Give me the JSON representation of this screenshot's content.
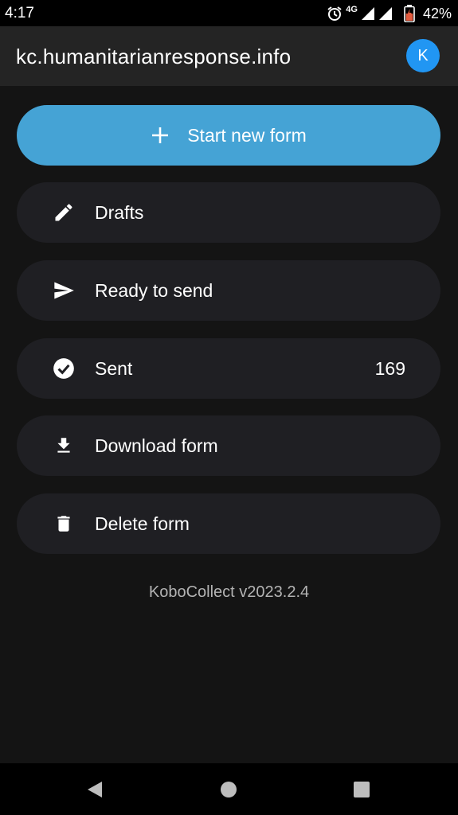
{
  "status_bar": {
    "time": "4:17",
    "network": "4G",
    "battery_percent": "42%"
  },
  "app_bar": {
    "title": "kc.humanitarianresponse.info",
    "avatar_letter": "K"
  },
  "actions": {
    "start_new_form": "Start new form",
    "drafts": "Drafts",
    "ready_to_send": "Ready to send",
    "sent": "Sent",
    "sent_count": "169",
    "download_form": "Download form",
    "delete_form": "Delete form"
  },
  "version": "KoboCollect v2023.2.4",
  "colors": {
    "primary": "#45a3d5",
    "avatar": "#2196F3",
    "background": "#141414",
    "card": "#1f1f23"
  }
}
